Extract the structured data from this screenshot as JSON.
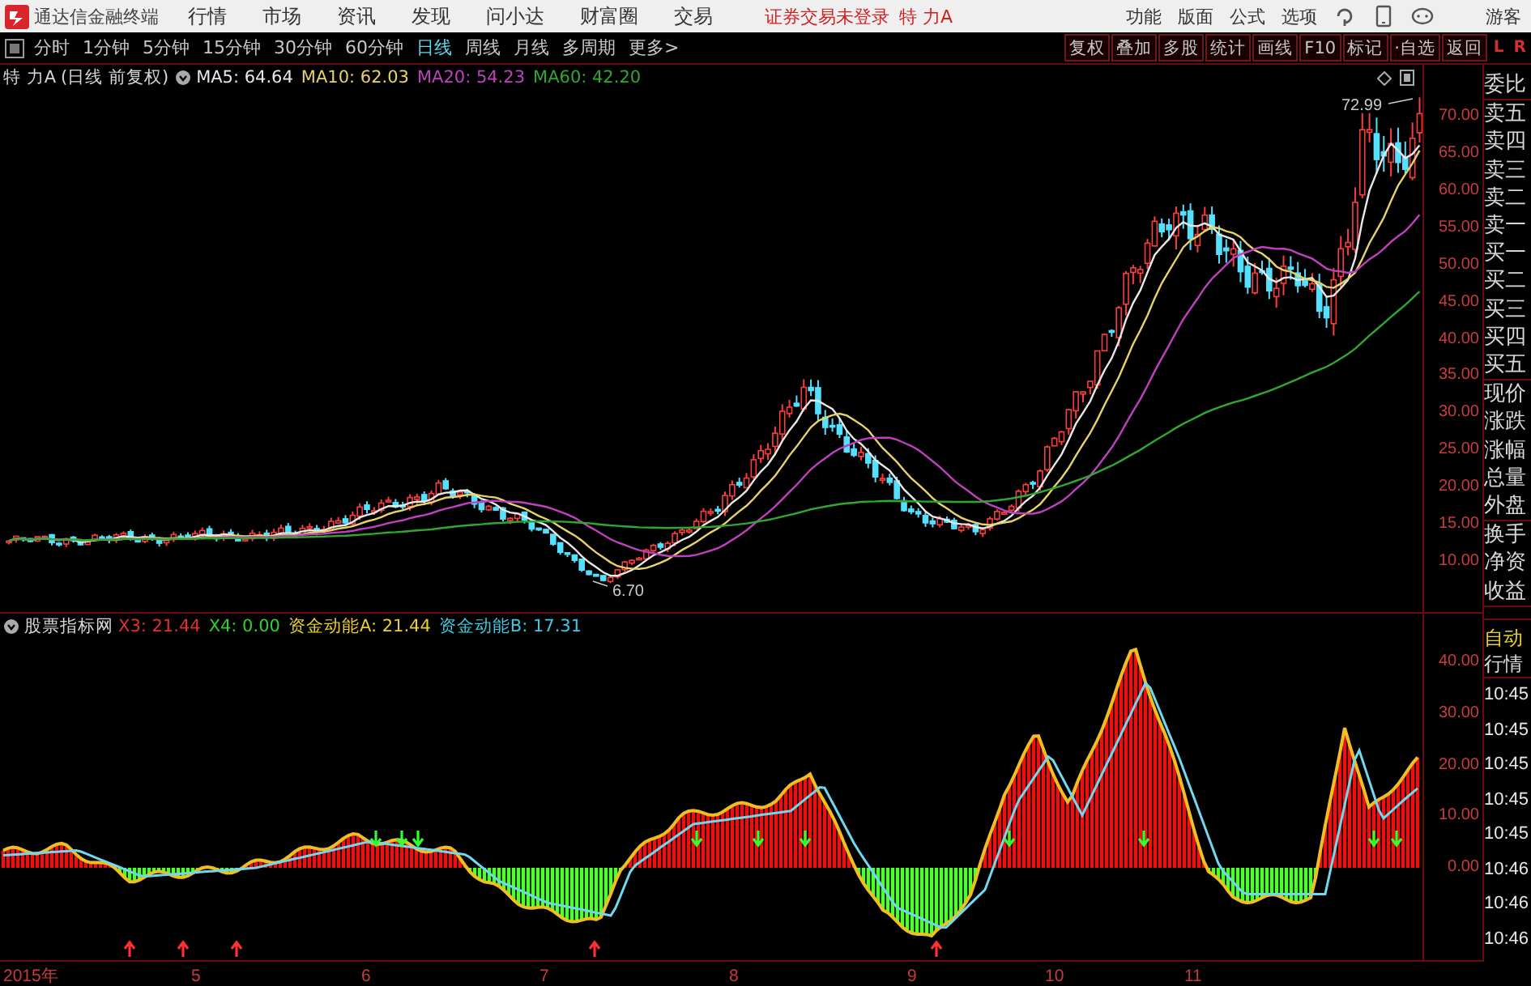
{
  "app": {
    "title": "通达信金融终端",
    "menu": [
      "行情",
      "市场",
      "资讯",
      "发现",
      "问小达",
      "财富圈",
      "交易"
    ],
    "status": "证券交易未登录",
    "stock": "特 力A",
    "tools": [
      "功能",
      "版面",
      "公式",
      "选项"
    ],
    "user": "游客"
  },
  "period_tabs": [
    {
      "label": "分时",
      "selected": false
    },
    {
      "label": "1分钟",
      "selected": false
    },
    {
      "label": "5分钟",
      "selected": false
    },
    {
      "label": "15分钟",
      "selected": false
    },
    {
      "label": "30分钟",
      "selected": false
    },
    {
      "label": "60分钟",
      "selected": false
    },
    {
      "label": "日线",
      "selected": true
    },
    {
      "label": "周线",
      "selected": false
    },
    {
      "label": "月线",
      "selected": false
    },
    {
      "label": "多周期",
      "selected": false
    },
    {
      "label": "更多>",
      "selected": false
    }
  ],
  "chart_tools": [
    "复权",
    "叠加",
    "多股",
    "统计",
    "画线",
    "F10",
    "标记",
    "·自选",
    "返回"
  ],
  "side_toggle": [
    "L",
    "R"
  ],
  "price_chart": {
    "title": "特 力A",
    "mode": "(日线 前复权)",
    "averages": [
      {
        "label": "MA5: 64.64",
        "color": "#e8e8e8"
      },
      {
        "label": "MA10: 62.03",
        "color": "#e8d36a"
      },
      {
        "label": "MA20: 54.23",
        "color": "#c040c0"
      },
      {
        "label": "MA60: 42.20",
        "color": "#30a830"
      }
    ],
    "axis": [
      "70.00",
      "65.00",
      "60.00",
      "55.00",
      "50.00",
      "45.00",
      "40.00",
      "35.00",
      "30.00",
      "25.00",
      "20.00",
      "15.00",
      "10.00"
    ],
    "high_label": "72.99",
    "low_label": "6.70"
  },
  "indicator": {
    "title": "股票指标网",
    "legend": [
      {
        "label": "X3: 21.44",
        "color": "#e03030"
      },
      {
        "label": "X4: 0.00",
        "color": "#30d030"
      },
      {
        "label": "资金动能A: 21.44",
        "color": "#e8d030"
      },
      {
        "label": "资金动能B: 17.31",
        "color": "#40c8e0"
      }
    ],
    "axis": [
      "40.00",
      "30.00",
      "20.00",
      "10.00",
      "0.00"
    ]
  },
  "time_axis": [
    "2015年",
    "5",
    "6",
    "7",
    "8",
    "9",
    "10",
    "11"
  ],
  "quote_panel": {
    "groups": [
      [
        "委比"
      ],
      [
        "卖五",
        "卖四",
        "卖三",
        "卖二",
        "卖一",
        "买一",
        "买二",
        "买三",
        "买四",
        "买五"
      ],
      [
        "现价",
        "涨跌",
        "涨幅",
        "总量",
        "外盘"
      ],
      [
        "换手",
        "净资",
        "收益"
      ]
    ]
  },
  "tick_panel": {
    "title": "自动",
    "subtitle": "行情",
    "times": [
      "10:45",
      "10:45",
      "10:45",
      "10:45",
      "10:45",
      "10:46",
      "10:46",
      "10:46"
    ]
  }
}
